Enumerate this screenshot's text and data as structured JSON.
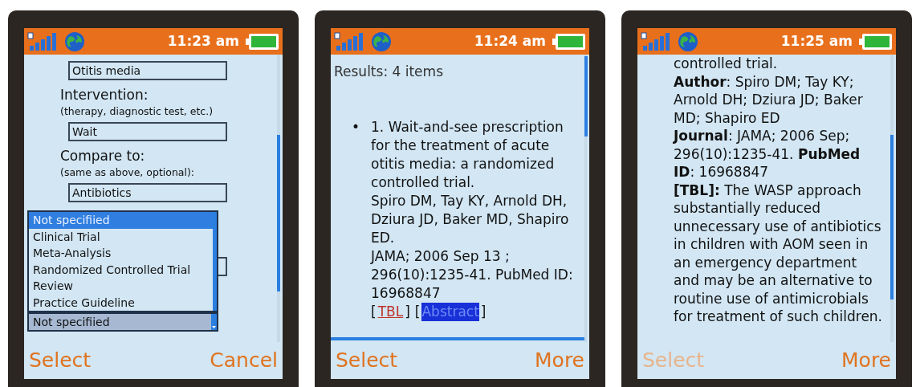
{
  "phones": [
    {
      "time": "11:23 am",
      "softkeys": [
        {
          "label": "Select",
          "disabled": false
        },
        {
          "label": "Cancel",
          "disabled": false
        }
      ],
      "screen": {
        "kind": "form",
        "items": [
          {
            "kind": "field",
            "value": "Otitis media"
          },
          {
            "kind": "label",
            "text": "Intervention:"
          },
          {
            "kind": "hint",
            "text": "(therapy, diagnostic test, etc.)"
          },
          {
            "kind": "field",
            "value": "Wait"
          },
          {
            "kind": "label",
            "text": "Compare to:"
          },
          {
            "kind": "hint",
            "text": "(same as above, optional):"
          },
          {
            "kind": "field",
            "value": "Antibiotics"
          }
        ],
        "dropdown": {
          "value": "Not specifiied",
          "expanded": true,
          "options": [
            {
              "label": "Not specifiied",
              "selected": true
            },
            {
              "label": "Clinical Trial",
              "selected": false
            },
            {
              "label": "Meta-Analysis",
              "selected": false
            },
            {
              "label": "Randomized Controlled Trial",
              "selected": false
            },
            {
              "label": "Review",
              "selected": false
            },
            {
              "label": "Practice Guideline",
              "selected": false
            }
          ]
        }
      }
    },
    {
      "time": "11:24 am",
      "softkeys": [
        {
          "label": "Select",
          "disabled": false
        },
        {
          "label": "More",
          "disabled": false
        }
      ],
      "screen": {
        "kind": "results",
        "header": "Results: 4 items",
        "result": {
          "bullet": "•",
          "title": "1. Wait-and-see prescription for the treatment of acute otitis media: a randomized controlled trial.",
          "authors": "Spiro DM, Tay KY, Arnold DH, Dziura JD, Baker MD, Shapiro ED.",
          "citation": "JAMA; 2006 Sep 13 ; 296(10):1235-41. PubMed ID: 16968847",
          "links": [
            {
              "open": "[",
              "label": "TBL",
              "close": "]",
              "selected": false
            },
            {
              "open": "[",
              "label": "Abstract",
              "close": "]",
              "selected": true
            }
          ]
        }
      }
    },
    {
      "time": "11:25 am",
      "softkeys": [
        {
          "label": "Select",
          "disabled": true
        },
        {
          "label": "More",
          "disabled": false
        }
      ],
      "screen": {
        "kind": "detail",
        "paragraphs": [
          "controlled trial.",
          "**Author**: Spiro DM; Tay KY; Arnold DH; Dziura JD; Baker MD; Shapiro ED",
          "**Journal**: JAMA; 2006 Sep; 296(10):1235-41. **PubMed ID**: 16968847",
          "**[TBL]:** The WASP approach substantially reduced unnecessary use of antibiotics in children with AOM seen in an emergency department and may be an alternative to routine use of antimicrobials for treatment of such children."
        ]
      }
    }
  ]
}
